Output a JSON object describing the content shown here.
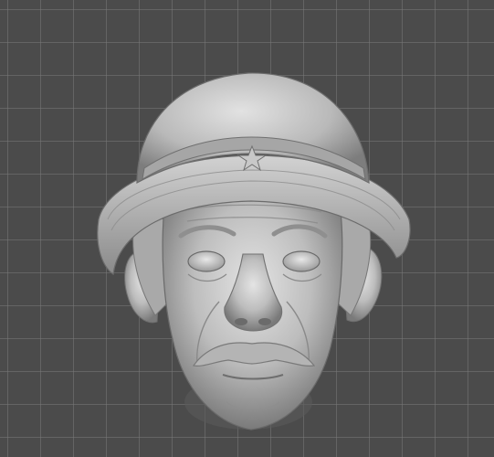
{
  "viewport": {
    "background_color": "#4b4b4b",
    "grid_color": "#787878"
  },
  "model": {
    "icon": "sculpted-head-icon",
    "material_color": "#c9c9c9",
    "shadow_color": "#6f6f6f"
  }
}
